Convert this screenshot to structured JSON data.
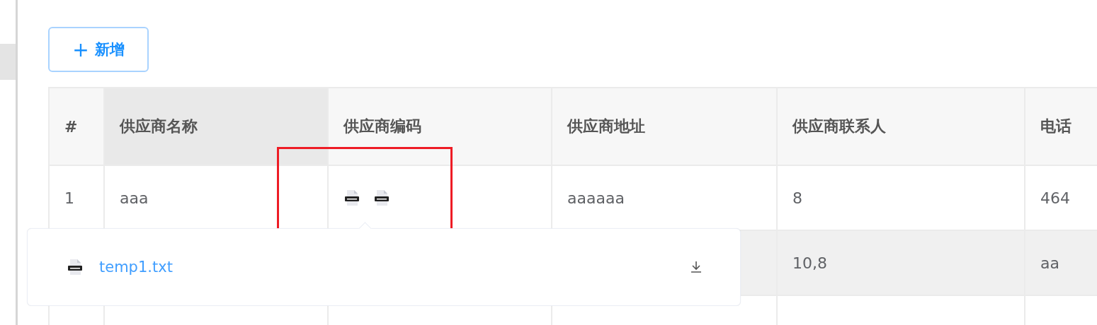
{
  "toolbar": {
    "add_button": {
      "icon": "+",
      "label": "新增"
    }
  },
  "table": {
    "columns": [
      {
        "label": "#",
        "sorted": false
      },
      {
        "label": "供应商名称",
        "sorted": true
      },
      {
        "label": "供应商编码",
        "sorted": false
      },
      {
        "label": "供应商地址",
        "sorted": false
      },
      {
        "label": "供应商联系人",
        "sorted": false
      },
      {
        "label": "电话",
        "sorted": false
      }
    ],
    "rows": [
      {
        "hovered": false,
        "cells": [
          {
            "kind": "text",
            "text": "1"
          },
          {
            "kind": "text",
            "text": "aaa"
          },
          {
            "kind": "files",
            "files": [
              {
                "kind": "other"
              },
              {
                "kind": "other"
              }
            ]
          },
          {
            "kind": "text",
            "text": "aaaaaa"
          },
          {
            "kind": "text",
            "text": "8"
          },
          {
            "kind": "text",
            "text": "464"
          }
        ]
      },
      {
        "hovered": true,
        "cells": [
          {
            "kind": "blank"
          },
          {
            "kind": "blank"
          },
          {
            "kind": "blank"
          },
          {
            "kind": "blank"
          },
          {
            "kind": "text",
            "text": "10,8"
          },
          {
            "kind": "text",
            "text": "aa"
          }
        ]
      },
      {
        "hovered": false,
        "cells": [
          {
            "kind": "blank"
          },
          {
            "kind": "blank"
          },
          {
            "kind": "blank"
          },
          {
            "kind": "blank"
          },
          {
            "kind": "blank"
          },
          {
            "kind": "blank"
          }
        ]
      }
    ]
  },
  "file_popover": {
    "files": [
      {
        "kind": "other",
        "name": "temp1.txt"
      }
    ]
  },
  "annotation": {
    "kind": "highlight"
  }
}
